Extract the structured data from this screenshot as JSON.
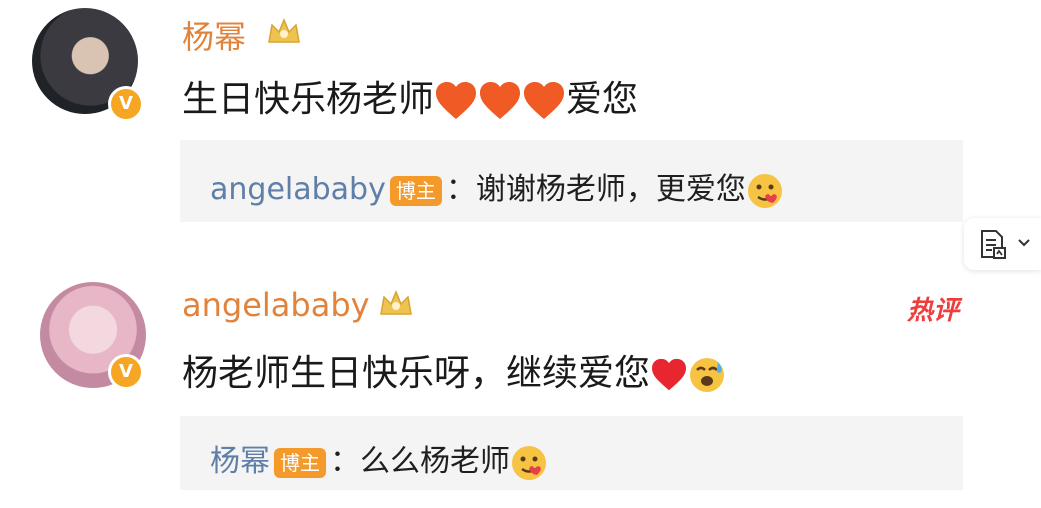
{
  "comments": [
    {
      "username": "杨幂",
      "text_main": "生日快乐杨老师",
      "text_suffix": "爱您",
      "hearts": 3,
      "reply": {
        "name": "angelababy",
        "badge": "博主",
        "text": "：谢谢杨老师，更爱您"
      }
    },
    {
      "username": "angelababy",
      "hot_label": "热评",
      "text_main": "杨老师生日快乐呀，继续爱您",
      "reply": {
        "name": "杨幂",
        "badge": "博主",
        "text": "：么么杨老师"
      }
    }
  ],
  "avatar_badge": "V",
  "icons": {
    "crown": "crown-icon",
    "heart": "heart-emoji",
    "face": "face-emoji",
    "doc": "document-icon",
    "chevron": "chevron-down-icon"
  },
  "colors": {
    "username": "#e2833c",
    "reply_name": "#5f7fa8",
    "badge": "#f39a2b",
    "hot": "#ef3d3d",
    "reply_bg": "#f4f4f4"
  }
}
